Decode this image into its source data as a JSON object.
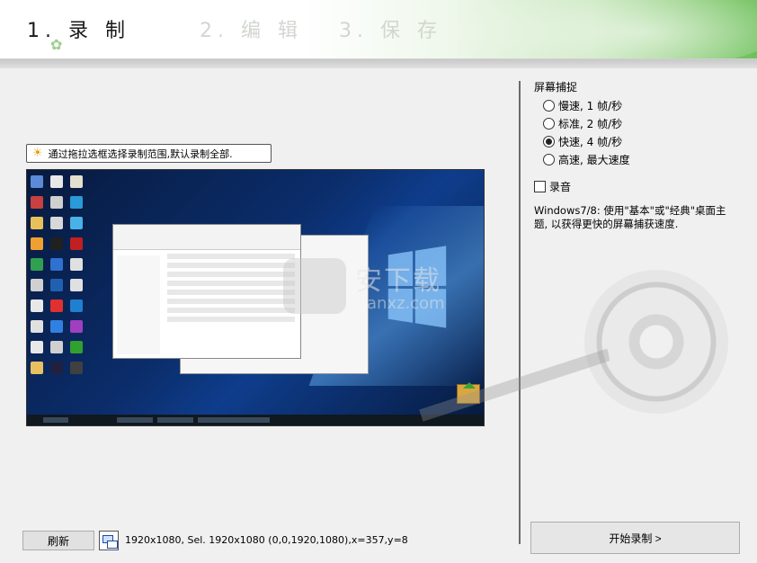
{
  "header": {
    "step1": "1. 录 制",
    "step2": "2. 编 辑",
    "step3": "3. 保 存"
  },
  "hint": {
    "text": "通过拖拉选框选择录制范围,默认录制全部."
  },
  "status": {
    "refresh_label": "刷新",
    "info_text": "1920x1080, Sel. 1920x1080 (0,0,1920,1080),x=357,y=8"
  },
  "capture": {
    "title": "屏幕捕捉",
    "options": [
      {
        "label": "慢速, 1 帧/秒",
        "checked": false
      },
      {
        "label": "标准, 2 帧/秒",
        "checked": false
      },
      {
        "label": "快速, 4 帧/秒",
        "checked": true
      },
      {
        "label": "高速, 最大速度",
        "checked": false
      }
    ],
    "audio_label": "录音",
    "audio_checked": false,
    "note": "Windows7/8: 使用\"基本\"或\"经典\"桌面主题, 以获得更快的屏幕捕获速度."
  },
  "actions": {
    "start_label": "开始录制 >"
  },
  "preview": {
    "watermark": "安下载",
    "watermark_sub": "anxz.com"
  }
}
